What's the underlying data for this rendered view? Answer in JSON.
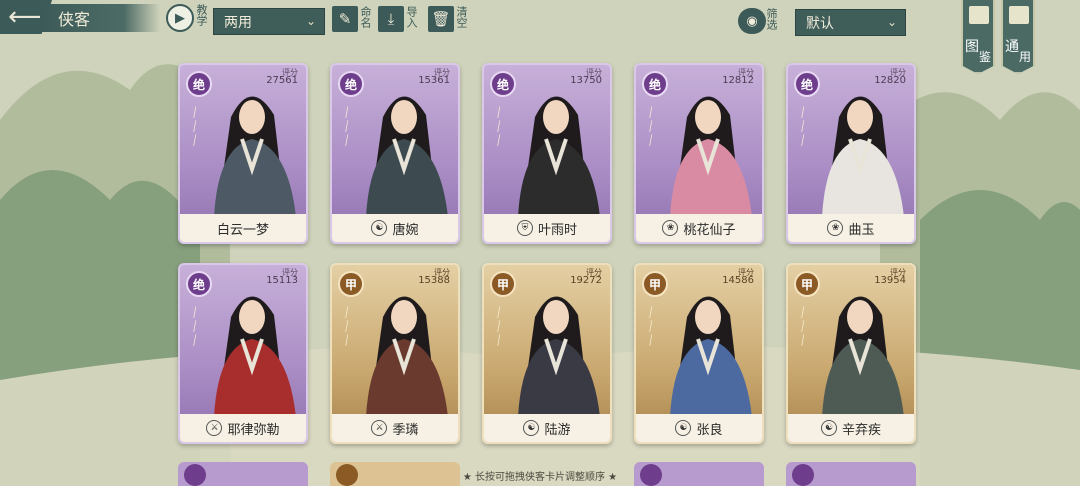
{
  "header": {
    "back_icon": "back-arrow-icon",
    "title": "侠客",
    "tutorial_label": "教学",
    "tutorial_icon": "play-icon",
    "filter_value": "两用",
    "rename_label": "命名",
    "import_label": "导入",
    "clear_label": "清空",
    "screen_label": "筛选",
    "sort_value": "默认",
    "atlas_label_1": "图",
    "atlas_label_2": "鉴",
    "general_label_1": "通",
    "general_label_2": "用"
  },
  "cards": [
    {
      "rank": "绝",
      "tier": "jue",
      "score_label": "评分",
      "score": "27561",
      "name": "白云一梦",
      "stars": 3,
      "robe": "#4d5a66",
      "sect_icon": ""
    },
    {
      "rank": "绝",
      "tier": "jue",
      "score_label": "评分",
      "score": "15361",
      "name": "唐婉",
      "stars": 3,
      "robe": "#3d4a4f",
      "sect_icon": "tai-chi-icon"
    },
    {
      "rank": "绝",
      "tier": "jue",
      "score_label": "评分",
      "score": "13750",
      "name": "叶雨时",
      "stars": 3,
      "robe": "#2c2c2c",
      "sect_icon": "shield-icon"
    },
    {
      "rank": "绝",
      "tier": "jue",
      "score_label": "评分",
      "score": "12812",
      "name": "桃花仙子",
      "stars": 3,
      "robe": "#d98ba3",
      "sect_icon": "lotus-icon"
    },
    {
      "rank": "绝",
      "tier": "jue",
      "score_label": "评分",
      "score": "12820",
      "name": "曲玉",
      "stars": 3,
      "robe": "#e8e4e0",
      "sect_icon": "lotus-icon"
    },
    {
      "rank": "绝",
      "tier": "jue",
      "score_label": "评分",
      "score": "15113",
      "name": "耶律弥勒",
      "stars": 3,
      "robe": "#a82d2d",
      "sect_icon": "sword-icon"
    },
    {
      "rank": "甲",
      "tier": "jia",
      "score_label": "评分",
      "score": "15388",
      "name": "季璘",
      "stars": 3,
      "robe": "#6b3a2f",
      "sect_icon": "sword-icon"
    },
    {
      "rank": "甲",
      "tier": "jia",
      "score_label": "评分",
      "score": "19272",
      "name": "陆游",
      "stars": 3,
      "robe": "#3a3a44",
      "sect_icon": "tai-chi-icon"
    },
    {
      "rank": "甲",
      "tier": "jia",
      "score_label": "评分",
      "score": "14586",
      "name": "张良",
      "stars": 3,
      "robe": "#4d6aa0",
      "sect_icon": "tai-chi-icon"
    },
    {
      "rank": "甲",
      "tier": "jia",
      "score_label": "评分",
      "score": "13954",
      "name": "辛弃疾",
      "stars": 3,
      "robe": "#4e5b55",
      "sect_icon": "tai-chi-icon"
    }
  ],
  "footer": {
    "hint": "★ 长按可拖拽侠客卡片调整顺序 ★"
  }
}
